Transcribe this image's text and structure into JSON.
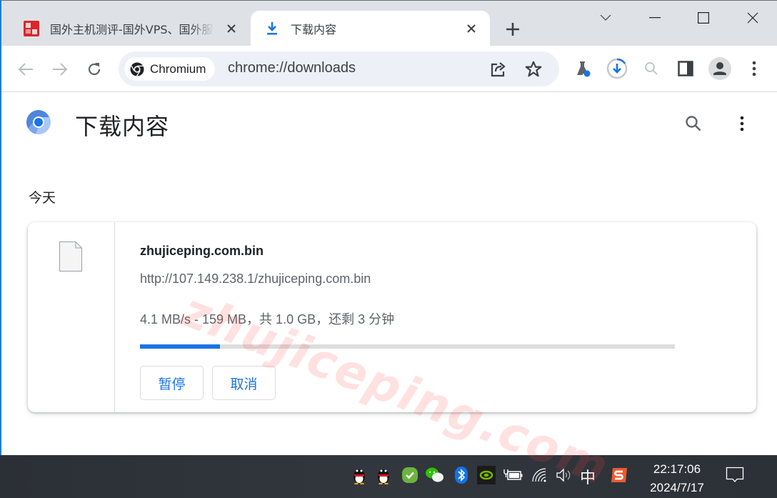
{
  "browser": {
    "tabs": [
      {
        "title": "国外主机测评-国外VPS、国外服务器",
        "active": false,
        "favicon": "site-seal-favicon"
      },
      {
        "title": "下载内容",
        "active": true,
        "favicon": "download-icon"
      }
    ],
    "new_tab_label": "+",
    "address_bar": {
      "chip_label": "Chromium",
      "url": "chrome://downloads"
    },
    "download_progress_ring_fraction": 0.16
  },
  "page": {
    "title": "下载内容",
    "section_date": "今天",
    "downloads": [
      {
        "file_name": "zhujiceping.com.bin",
        "url": "http://107.149.238.1/zhujiceping.com.bin",
        "status": "4.1 MB/s - 159 MB，共 1.0 GB，还剩 3 分钟",
        "progress_fraction": 0.149,
        "pause_label": "暂停",
        "cancel_label": "取消"
      }
    ],
    "watermark": "zhujiceping.com"
  },
  "taskbar": {
    "ime_label": "中",
    "time": "22:17:06",
    "date": "2024/7/17"
  },
  "colors": {
    "accent": "#1a73e8",
    "tabstrip": "#dee1e6",
    "omnibox": "#edf0f7",
    "taskbar": "#2f343a",
    "watermark": "#ff4646"
  }
}
